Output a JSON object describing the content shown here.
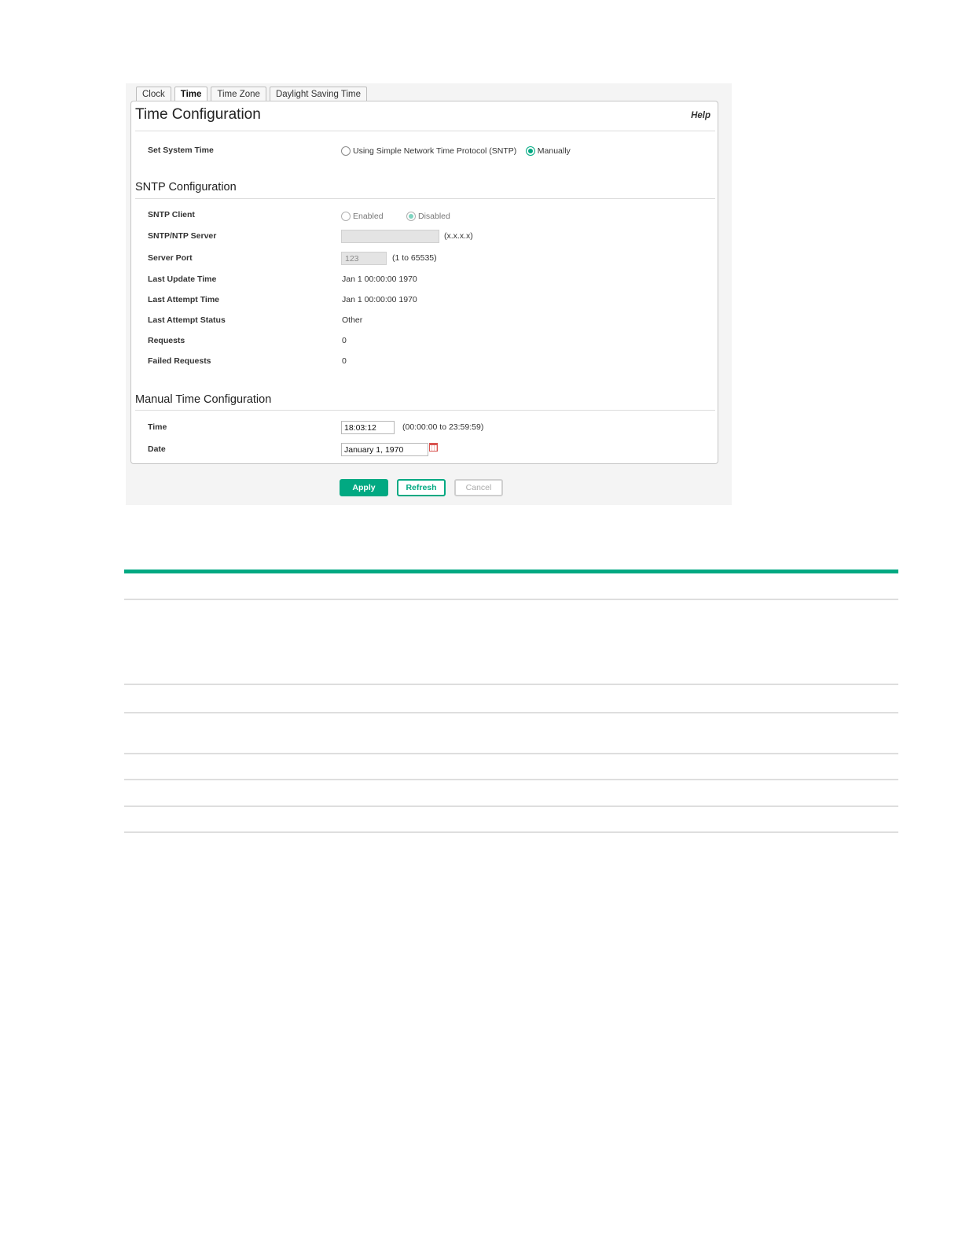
{
  "tabs": {
    "clock": "Clock",
    "time": "Time",
    "time_zone": "Time Zone",
    "daylight": "Daylight Saving Time"
  },
  "panel": {
    "title": "Time Configuration",
    "help": "Help"
  },
  "set_system_time": {
    "label": "Set System Time",
    "option_sntp": "Using Simple Network Time Protocol (SNTP)",
    "option_manual": "Manually",
    "selected": "Manually"
  },
  "sntp": {
    "title": "SNTP Configuration",
    "client_label": "SNTP Client",
    "client_enabled": "Enabled",
    "client_disabled": "Disabled",
    "client_selected": "Disabled",
    "server_label": "SNTP/NTP Server",
    "server_value": "",
    "server_hint": "(x.x.x.x)",
    "port_label": "Server Port",
    "port_value": "123",
    "port_hint": "(1 to 65535)",
    "last_update_label": "Last Update Time",
    "last_update_value": "Jan 1 00:00:00 1970",
    "last_attempt_label": "Last Attempt Time",
    "last_attempt_value": "Jan 1 00:00:00 1970",
    "last_status_label": "Last Attempt Status",
    "last_status_value": "Other",
    "requests_label": "Requests",
    "requests_value": "0",
    "failed_label": "Failed Requests",
    "failed_value": "0"
  },
  "manual": {
    "title": "Manual Time Configuration",
    "time_label": "Time",
    "time_value": "18:03:12",
    "time_hint": "(00:00:00 to 23:59:59)",
    "date_label": "Date",
    "date_value": "January 1, 1970"
  },
  "buttons": {
    "apply": "Apply",
    "refresh": "Refresh",
    "cancel": "Cancel"
  },
  "colors": {
    "accent": "#01a982"
  }
}
